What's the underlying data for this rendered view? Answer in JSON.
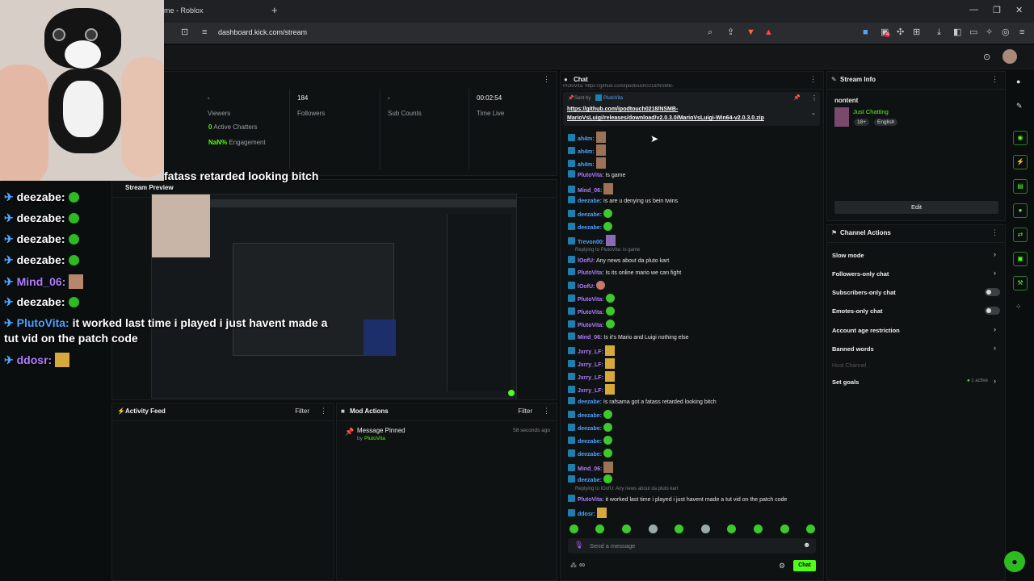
{
  "browser": {
    "tab_title": "me - Roblox",
    "new_tab": "+",
    "url": "dashboard.kick.com/stream",
    "window_controls": [
      "—",
      "❐",
      "✕"
    ],
    "notification_badge": "4"
  },
  "stats": [
    {
      "value": "-",
      "label": "Viewers"
    },
    {
      "value": "184",
      "label": "Followers"
    },
    {
      "value": "-",
      "label": "Sub Counts"
    },
    {
      "value": "00:02:54",
      "label": "Time Live"
    }
  ],
  "active_chatters": {
    "value": "0",
    "label": "Active Chatters"
  },
  "engagement": {
    "value": "NaN%",
    "label": "Engagement"
  },
  "overlay": {
    "top_text": "fatass retarded looking bitch",
    "lines": [
      {
        "user": "deezabe:"
      },
      {
        "user": "deezabe:"
      },
      {
        "user": "deezabe:"
      },
      {
        "user": "deezabe:"
      },
      {
        "user": "Mind_06:"
      },
      {
        "user": "deezabe:"
      },
      {
        "user": "PlutoVita:",
        "text": " it worked last time i played i just havent made a"
      },
      {
        "user": "",
        "text": "tut vid on the patch code"
      },
      {
        "user": "ddosr:"
      }
    ]
  },
  "stream_preview": {
    "title": "Stream Preview"
  },
  "activity_feed": {
    "title": "Activity Feed",
    "filter": "Filter"
  },
  "mod_actions": {
    "title": "Mod Actions",
    "filter": "Filter",
    "item_title": "Message Pinned",
    "item_by": "by",
    "item_user": "PlutoVita",
    "item_time": "58 seconds ago"
  },
  "chat": {
    "title": "Chat",
    "pinned_top": "PlutoVita: https://github.com/ipodtouch0218/NSMB-",
    "pinned_sent_by": "Sent by",
    "pinned_user": "PlutoVita",
    "pinned_link_1": "https://github.com/ipodtouch0218/NSMB-",
    "pinned_link_2": "MarioVsLuigi/releases/download/v2.0.3.0/MarioVsLuigi-Win64-v2.0.3.0.zip",
    "messages": [
      {
        "user": "ah4m:",
        "color": "#4da3ff",
        "emote": "b"
      },
      {
        "user": "ah4m:",
        "color": "#4da3ff",
        "emote": "b"
      },
      {
        "user": "ah4m:",
        "color": "#4da3ff",
        "emote": "b"
      },
      {
        "user": "PlutoVita:",
        "color": "#b17cff",
        "text": " Is game"
      },
      {
        "user": "Mind_06:",
        "color": "#b17cff",
        "emote": "b"
      },
      {
        "user": "deezabe:",
        "color": "#4da3ff",
        "text": " Is are u denying us bein twins"
      },
      {
        "user": "deezabe:",
        "color": "#4da3ff",
        "emote": "g"
      },
      {
        "user": "deezabe:",
        "color": "#4da3ff",
        "emote": "g"
      },
      {
        "user": "Trevon00:",
        "color": "#4da3ff",
        "emote": "p"
      },
      {
        "reply": "Replying to PlutoVita: Is game"
      },
      {
        "user": "lOofU:",
        "color": "#b17cff",
        "text": " Any news about da pluto kart"
      },
      {
        "user": "PlutoVita:",
        "color": "#b17cff",
        "text": " Is its online mario we can fight"
      },
      {
        "user": "lOofU:",
        "color": "#b17cff",
        "emote": "r"
      },
      {
        "user": "PlutoVita:",
        "color": "#b17cff",
        "emote": "g"
      },
      {
        "user": "PlutoVita:",
        "color": "#b17cff",
        "emote": "g"
      },
      {
        "user": "PlutoVita:",
        "color": "#b17cff",
        "emote": "g"
      },
      {
        "user": "Mind_06:",
        "color": "#b17cff",
        "text": " Is it's Mario and Luigi nothing else"
      },
      {
        "user": "Jxrry_LF:",
        "color": "#b17cff",
        "emote": "y"
      },
      {
        "user": "Jxrry_LF:",
        "color": "#b17cff",
        "emote": "y"
      },
      {
        "user": "Jxrry_LF:",
        "color": "#b17cff",
        "emote": "y"
      },
      {
        "user": "Jxrry_LF:",
        "color": "#b17cff",
        "emote": "y"
      },
      {
        "user": "deezabe:",
        "color": "#4da3ff",
        "text": " Is rafsama got a fatass retarded looking bitch"
      },
      {
        "user": "deezabe:",
        "color": "#4da3ff",
        "emote": "g"
      },
      {
        "user": "deezabe:",
        "color": "#4da3ff",
        "emote": "g"
      },
      {
        "user": "deezabe:",
        "color": "#4da3ff",
        "emote": "g"
      },
      {
        "user": "deezabe:",
        "color": "#4da3ff",
        "emote": "g"
      },
      {
        "user": "Mind_06:",
        "color": "#b17cff",
        "emote": "b"
      },
      {
        "user": "deezabe:",
        "color": "#4da3ff",
        "emote": "g"
      },
      {
        "reply": "Replying to lOofU: Any news about da pluto kart"
      },
      {
        "user": "PlutoVita:",
        "color": "#b17cff",
        "text": " it worked last time i played i just havent made a tut vid on the patch code"
      },
      {
        "user": "ddosr:",
        "color": "#4da3ff",
        "emote": "y"
      }
    ],
    "input_placeholder": "Send a message",
    "send_label": "Chat",
    "infinity": "∞"
  },
  "stream_info": {
    "title": "Stream Info",
    "stream_title": "nontent",
    "category": "Just Chatting",
    "tags": [
      "18+",
      "English"
    ],
    "edit_label": "Edit"
  },
  "channel_actions": {
    "title": "Channel Actions",
    "items": [
      "Slow mode",
      "Followers-only chat",
      "Subscribers-only chat",
      "Emotes-only chat",
      "Account age restriction",
      "Banned words"
    ],
    "host_channel": "Host Channel",
    "set_goals": "Set goals",
    "goals_active": "1 active"
  },
  "colors": {
    "accent": "#53fc18",
    "bg": "#0b0e0f",
    "panel": "#0f1213"
  }
}
